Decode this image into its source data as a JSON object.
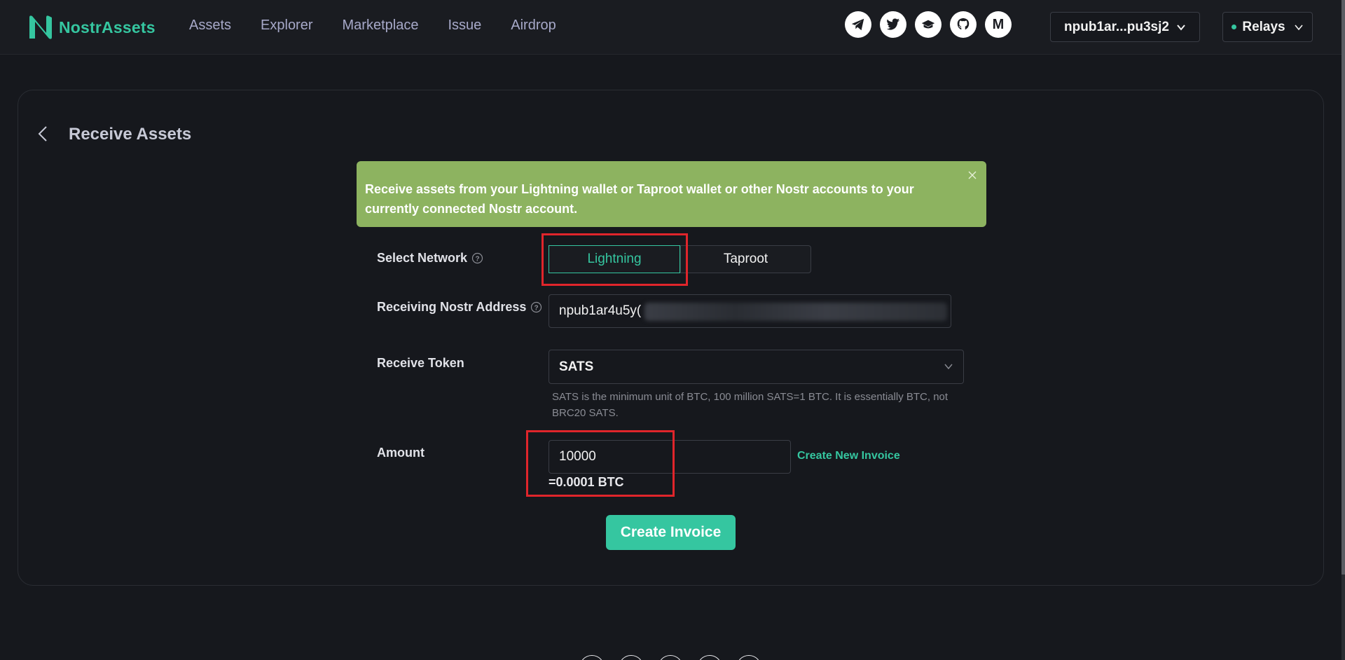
{
  "brand": {
    "name": "NostrAssets",
    "color": "#35c6a0"
  },
  "nav": {
    "items": [
      "Assets",
      "Explorer",
      "Marketplace",
      "Issue",
      "Airdrop"
    ]
  },
  "socials": [
    "telegram-icon",
    "twitter-icon",
    "gitbook-icon",
    "github-icon",
    "medium-icon"
  ],
  "social_medium_glyph": "M",
  "account": {
    "label": "npub1ar...pu3sj2"
  },
  "relays": {
    "label": "Relays",
    "status_color": "#35c6a0"
  },
  "page": {
    "title": "Receive Assets"
  },
  "alert": {
    "text": "Receive assets from your Lightning wallet or Taproot wallet or other Nostr accounts to your currently connected Nostr account.",
    "color": "#8db360"
  },
  "form": {
    "network": {
      "label": "Select Network",
      "options": [
        "Lightning",
        "Taproot"
      ],
      "selected": "Lightning"
    },
    "address": {
      "label": "Receiving Nostr Address",
      "value": "npub1ar4u5y("
    },
    "token": {
      "label": "Receive Token",
      "value": "SATS",
      "hint": "SATS is the minimum unit of BTC, 100 million SATS=1 BTC. It is essentially BTC, not BRC20 SATS."
    },
    "amount": {
      "label": "Amount",
      "value": "10000",
      "converted": "=0.0001 BTC",
      "link": "Create New Invoice"
    },
    "submit": "Create Invoice"
  }
}
